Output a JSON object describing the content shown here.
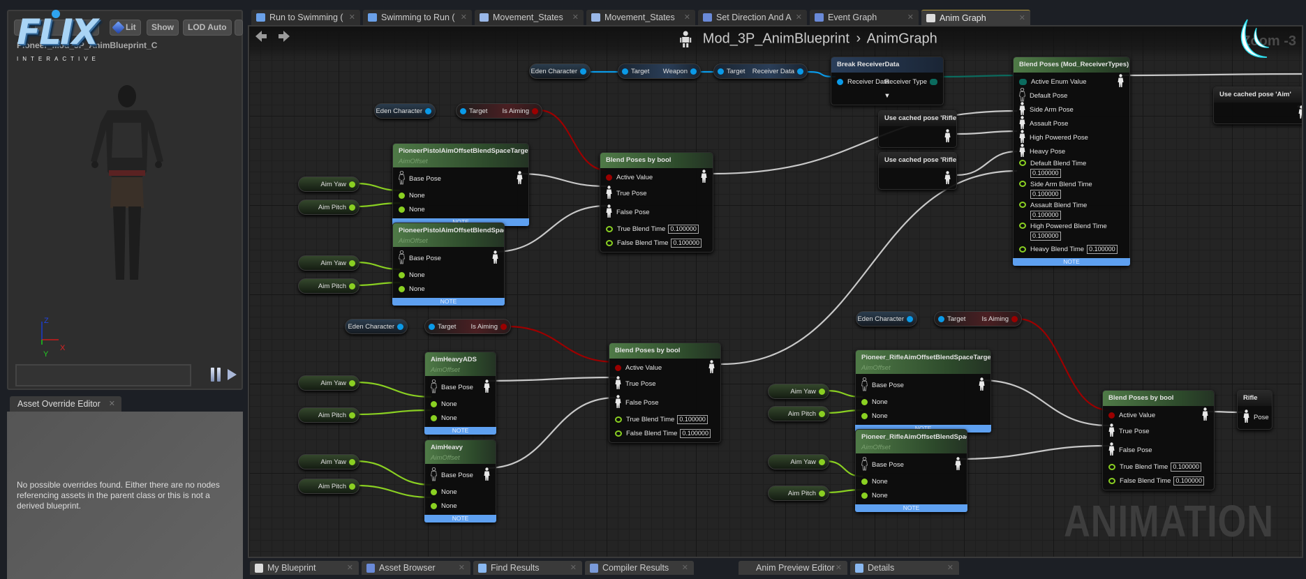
{
  "logo": {
    "brand": "FLIX",
    "tagline": "INTERACTIVE"
  },
  "viewport": {
    "toolbar": {
      "lit": "Lit",
      "show": "Show",
      "lod": "LOD Auto"
    },
    "title": "Pioneer_Mod_3P_AnimBlueprint_C",
    "axes": {
      "z": "Z",
      "x": "X",
      "y": "Y"
    },
    "controls": {
      "pause_icon": "pause-icon",
      "step_icon": "step-forward-icon"
    }
  },
  "asset_override": {
    "tab": "Asset Override Editor",
    "message": "No possible overrides found. Either there are no nodes referencing assets in the parent class or this is not a derived blueprint."
  },
  "tabs": [
    {
      "label": "Run to Swimming (",
      "icon": "transition-icon"
    },
    {
      "label": "Swimming to Run (",
      "icon": "transition-icon"
    },
    {
      "label": "Movement_States",
      "icon": "state-machine-icon"
    },
    {
      "label": "Movement_States",
      "icon": "state-machine-icon"
    },
    {
      "label": "Set Direction And A",
      "icon": "graph-icon"
    },
    {
      "label": "Event Graph",
      "icon": "graph-icon"
    },
    {
      "label": "Anim Graph",
      "icon": "anim-graph-icon",
      "active": true
    }
  ],
  "bottom_tabs": [
    {
      "label": "My Blueprint",
      "icon": "book-icon"
    },
    {
      "label": "Asset Browser",
      "icon": "asset-browser-icon"
    },
    {
      "label": "Find Results",
      "icon": "search-icon"
    },
    {
      "label": "Compiler Results",
      "icon": "compiler-icon"
    },
    {
      "label": "Anim Preview Editor",
      "icon": ""
    },
    {
      "label": "Details",
      "icon": "info-icon"
    }
  ],
  "graph": {
    "breadcrumb": {
      "blueprint": "Mod_3P_AnimBlueprint",
      "separator": "›",
      "graph": "AnimGraph"
    },
    "zoom": "Zoom -3",
    "watermark": "ANIMATION",
    "colors": {
      "bool": "#9b0000",
      "object": "#0a9ae8",
      "enum": "#0b6b5e",
      "float": "#8ad022",
      "pose": "#d8d8d8",
      "note": "#5ea0f0"
    },
    "nodes": [
      {
        "kind": "var",
        "label": "Eden Character",
        "pin": "object"
      },
      {
        "kind": "get",
        "style": "blue",
        "in": "Target",
        "out": "Weapon",
        "out_pin": "object"
      },
      {
        "kind": "get",
        "style": "blue",
        "in": "Target",
        "out": "Receiver Data",
        "out_pin": "object"
      },
      {
        "kind": "node",
        "header": "blue",
        "title": "Break ReceiverData",
        "rows": [
          {
            "label": "Receiver Data",
            "pin": "object",
            "out_label": "Receiver Type",
            "out": "enum"
          },
          {
            "label": "▼",
            "pin": ""
          }
        ]
      },
      {
        "kind": "node",
        "header": "green",
        "title": "Blend Poses (Mod_ReceiverTypes)",
        "footer": "NOTE",
        "rows": [
          {
            "label": "Active Enum Value",
            "pin": "enum",
            "out": "pose"
          },
          {
            "label": "Default Pose",
            "pin": "pose-ref"
          },
          {
            "label": "Side Arm Pose",
            "pin": "pose"
          },
          {
            "label": "Assault Pose",
            "pin": "pose"
          },
          {
            "label": "High Powered Pose",
            "pin": "pose"
          },
          {
            "label": "Heavy Pose",
            "pin": "pose"
          },
          {
            "label": "Default Blend Time",
            "pin": "float",
            "value": "0.100000",
            "stack": true
          },
          {
            "label": "Side Arm Blend Time",
            "pin": "float",
            "value": "0.100000",
            "stack": true
          },
          {
            "label": "Assault Blend Time",
            "pin": "float",
            "value": "0.100000",
            "stack": true
          },
          {
            "label": "High Powered Blend Time",
            "pin": "float",
            "value": "0.100000",
            "stack": true
          },
          {
            "label": "Heavy Blend Time",
            "pin": "float",
            "value": "0.100000"
          }
        ]
      },
      {
        "kind": "node",
        "header": "dark",
        "title": "Use cached pose 'Aim'",
        "rows": [
          {
            "label": "",
            "pin": "",
            "out": "pose"
          }
        ]
      },
      {
        "kind": "node",
        "header": "dark",
        "title": "Use cached pose 'Rifle'",
        "rows": [
          {
            "label": "",
            "pin": "",
            "out": "pose"
          }
        ]
      },
      {
        "kind": "node",
        "header": "dark",
        "title": "Use cached pose 'Rifle'",
        "rows": [
          {
            "label": "",
            "pin": "",
            "out": "pose"
          }
        ]
      },
      {
        "kind": "var",
        "label": "Eden Character",
        "pin": "object"
      },
      {
        "kind": "get",
        "style": "red",
        "in": "Target",
        "out": "Is Aiming",
        "out_pin": "bool"
      },
      {
        "kind": "node",
        "header": "green",
        "title": "PioneerPistolAimOffsetBlendSpaceTargeting",
        "subtitle": "AimOffset",
        "footer": "NOTE",
        "rows": [
          {
            "label": "Base Pose",
            "pin": "pose-ref",
            "out": "pose",
            "tall": true
          },
          {
            "label": "None",
            "pin": "float-var"
          },
          {
            "label": "None",
            "pin": "float-var"
          }
        ]
      },
      {
        "kind": "node",
        "header": "green",
        "title": "PioneerPistolAimOffsetBlendSpace",
        "subtitle": "AimOffset",
        "footer": "NOTE",
        "rows": [
          {
            "label": "Base Pose",
            "pin": "pose-ref",
            "out": "pose",
            "tall": true
          },
          {
            "label": "None",
            "pin": "float-var"
          },
          {
            "label": "None",
            "pin": "float-var"
          }
        ]
      },
      {
        "kind": "node",
        "header": "green",
        "title": "Blend Poses by bool",
        "rows": [
          {
            "label": "Active Value",
            "pin": "bool",
            "out": "pose"
          },
          {
            "label": "True Pose",
            "pin": "pose",
            "tall": true
          },
          {
            "label": "False Pose",
            "pin": "pose",
            "tall": true
          },
          {
            "label": "True Blend Time",
            "pin": "float",
            "value": "0.100000"
          },
          {
            "label": "False Blend Time",
            "pin": "float",
            "value": "0.100000"
          }
        ]
      },
      {
        "kind": "var",
        "style": "green",
        "label": "Aim Yaw",
        "pin": "float-var"
      },
      {
        "kind": "var",
        "style": "green",
        "label": "Aim Pitch",
        "pin": "float-var"
      },
      {
        "kind": "var",
        "style": "green",
        "label": "Aim Yaw",
        "pin": "float-var"
      },
      {
        "kind": "var",
        "style": "green",
        "label": "Aim Pitch",
        "pin": "float-var"
      },
      {
        "kind": "var",
        "label": "Eden Character",
        "pin": "object"
      },
      {
        "kind": "get",
        "style": "red",
        "in": "Target",
        "out": "Is Aiming",
        "out_pin": "bool"
      },
      {
        "kind": "node",
        "header": "green",
        "title": "AimHeavyADS",
        "subtitle": "AimOffset",
        "footer": "NOTE",
        "rows": [
          {
            "label": "Base Pose",
            "pin": "pose-ref",
            "out": "pose",
            "tall": true
          },
          {
            "label": "None",
            "pin": "float-var"
          },
          {
            "label": "None",
            "pin": "float-var"
          }
        ]
      },
      {
        "kind": "node",
        "header": "green",
        "title": "AimHeavy",
        "subtitle": "AimOffset",
        "footer": "NOTE",
        "rows": [
          {
            "label": "Base Pose",
            "pin": "pose-ref",
            "out": "pose",
            "tall": true
          },
          {
            "label": "None",
            "pin": "float-var"
          },
          {
            "label": "None",
            "pin": "float-var"
          }
        ]
      },
      {
        "kind": "var",
        "style": "green",
        "label": "Aim Yaw",
        "pin": "float-var"
      },
      {
        "kind": "var",
        "style": "green",
        "label": "Aim Pitch",
        "pin": "float-var"
      },
      {
        "kind": "var",
        "style": "green",
        "label": "Aim Yaw",
        "pin": "float-var"
      },
      {
        "kind": "var",
        "style": "green",
        "label": "Aim Pitch",
        "pin": "float-var"
      },
      {
        "kind": "node",
        "header": "green",
        "title": "Blend Poses by bool",
        "rows": [
          {
            "label": "Active Value",
            "pin": "bool",
            "out": "pose"
          },
          {
            "label": "True Pose",
            "pin": "pose",
            "tall": true
          },
          {
            "label": "False Pose",
            "pin": "pose",
            "tall": true
          },
          {
            "label": "True Blend Time",
            "pin": "float",
            "value": "0.100000"
          },
          {
            "label": "False Blend Time",
            "pin": "float",
            "value": "0.100000"
          }
        ]
      },
      {
        "kind": "var",
        "label": "Eden Character",
        "pin": "object"
      },
      {
        "kind": "get",
        "style": "red",
        "in": "Target",
        "out": "Is Aiming",
        "out_pin": "bool"
      },
      {
        "kind": "node",
        "header": "green",
        "title": "Pioneer_RifleAimOffsetBlendSpaceTargeting",
        "subtitle": "AimOffset",
        "footer": "NOTE",
        "rows": [
          {
            "label": "Base Pose",
            "pin": "pose-ref",
            "out": "pose",
            "tall": true
          },
          {
            "label": "None",
            "pin": "float-var"
          },
          {
            "label": "None",
            "pin": "float-var"
          }
        ]
      },
      {
        "kind": "node",
        "header": "green",
        "title": "Pioneer_RifleAimOffsetBlendSpace",
        "subtitle": "AimOffset",
        "footer": "NOTE",
        "rows": [
          {
            "label": "Base Pose",
            "pin": "pose-ref",
            "out": "pose",
            "tall": true
          },
          {
            "label": "None",
            "pin": "float-var"
          },
          {
            "label": "None",
            "pin": "float-var"
          }
        ]
      },
      {
        "kind": "var",
        "style": "green",
        "label": "Aim Yaw",
        "pin": "float-var"
      },
      {
        "kind": "var",
        "style": "green",
        "label": "Aim Pitch",
        "pin": "float-var"
      },
      {
        "kind": "var",
        "style": "green",
        "label": "Aim Yaw",
        "pin": "float-var"
      },
      {
        "kind": "var",
        "style": "green",
        "label": "Aim Pitch",
        "pin": "float-var"
      },
      {
        "kind": "node",
        "header": "green",
        "title": "Blend Poses by bool",
        "rows": [
          {
            "label": "Active Value",
            "pin": "bool",
            "out": "pose"
          },
          {
            "label": "True Pose",
            "pin": "pose",
            "tall": true
          },
          {
            "label": "False Pose",
            "pin": "pose",
            "tall": true
          },
          {
            "label": "True Blend Time",
            "pin": "float",
            "value": "0.100000"
          },
          {
            "label": "False Blend Time",
            "pin": "float",
            "value": "0.100000"
          }
        ]
      },
      {
        "kind": "node",
        "header": "dark",
        "title": "Rifle",
        "rows": [
          {
            "label": "Pose",
            "pin": "pose",
            "tall": true
          }
        ]
      }
    ]
  }
}
